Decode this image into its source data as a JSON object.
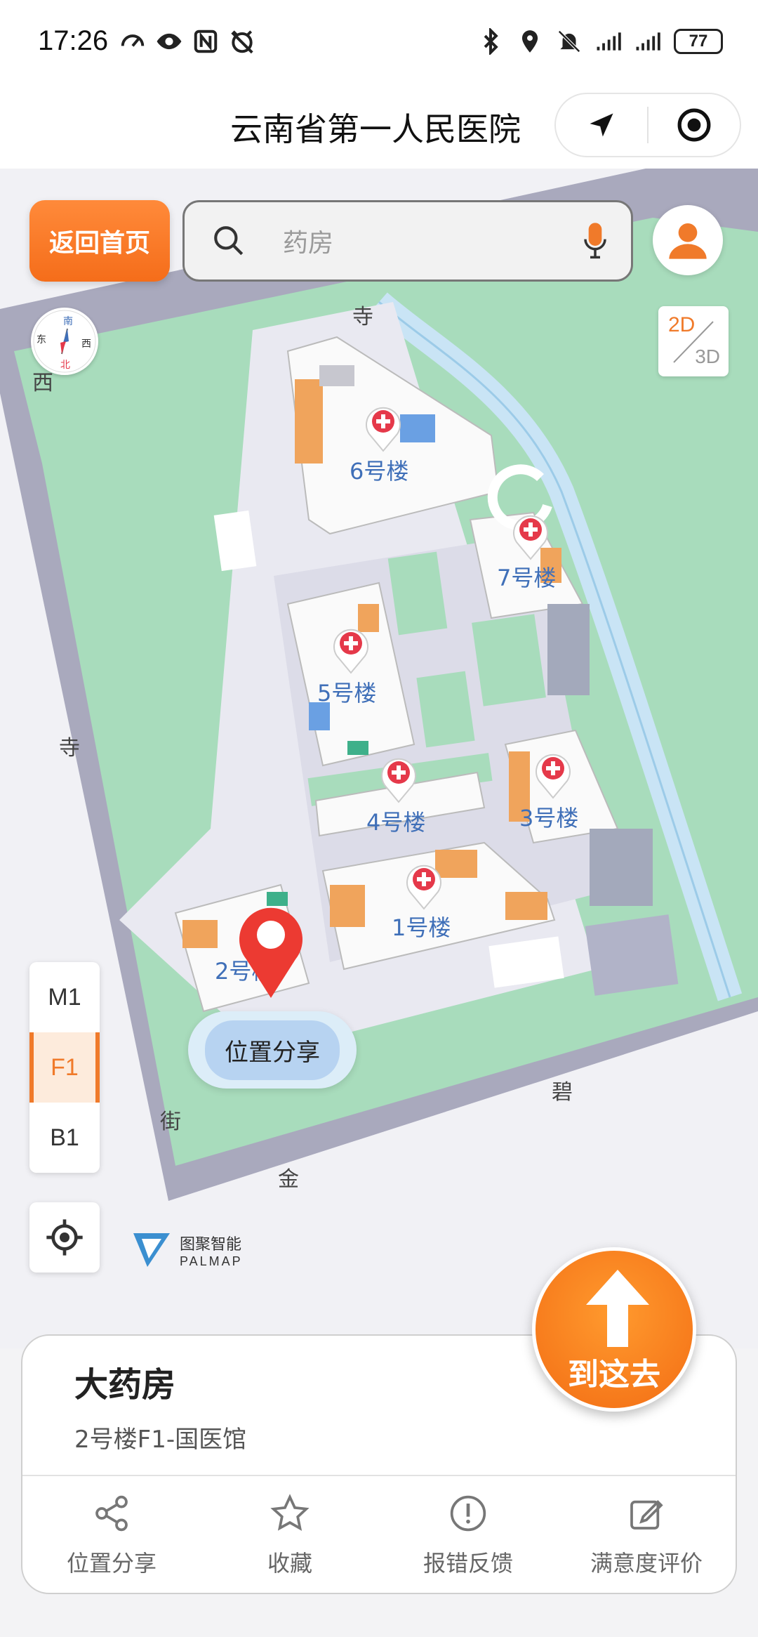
{
  "status_bar": {
    "time": "17:26",
    "battery": "77"
  },
  "title_bar": {
    "title": "云南省第一人民医院"
  },
  "map_controls": {
    "home_button": "返回首页",
    "search_placeholder": "药房",
    "toggle_2d": "2D",
    "toggle_3d": "3D",
    "floors": [
      "M1",
      "F1",
      "B1"
    ],
    "active_floor": "F1",
    "compass_labels": {
      "n": "南",
      "s": "北",
      "e": "西",
      "w": "东"
    },
    "brand_cn": "图聚智能",
    "brand_en": "PALMAP"
  },
  "map": {
    "buildings": [
      "6号楼",
      "7号楼",
      "5号楼",
      "4号楼",
      "3号楼",
      "1号楼",
      "2号楼"
    ],
    "roads": [
      "寺",
      "西",
      "寺",
      "街",
      "金",
      "碧"
    ],
    "share_bubble": "位置分享"
  },
  "goto_button": "到这去",
  "info_card": {
    "title": "大药房",
    "subtitle": "2号楼F1-国医馆",
    "actions": [
      "位置分享",
      "收藏",
      "报错反馈",
      "满意度评价"
    ]
  },
  "colors": {
    "accent_orange": "#f36d14",
    "map_green": "#a8dcbc",
    "road_gray": "#a9a9bd",
    "building_blue": "#3f6fb8"
  }
}
